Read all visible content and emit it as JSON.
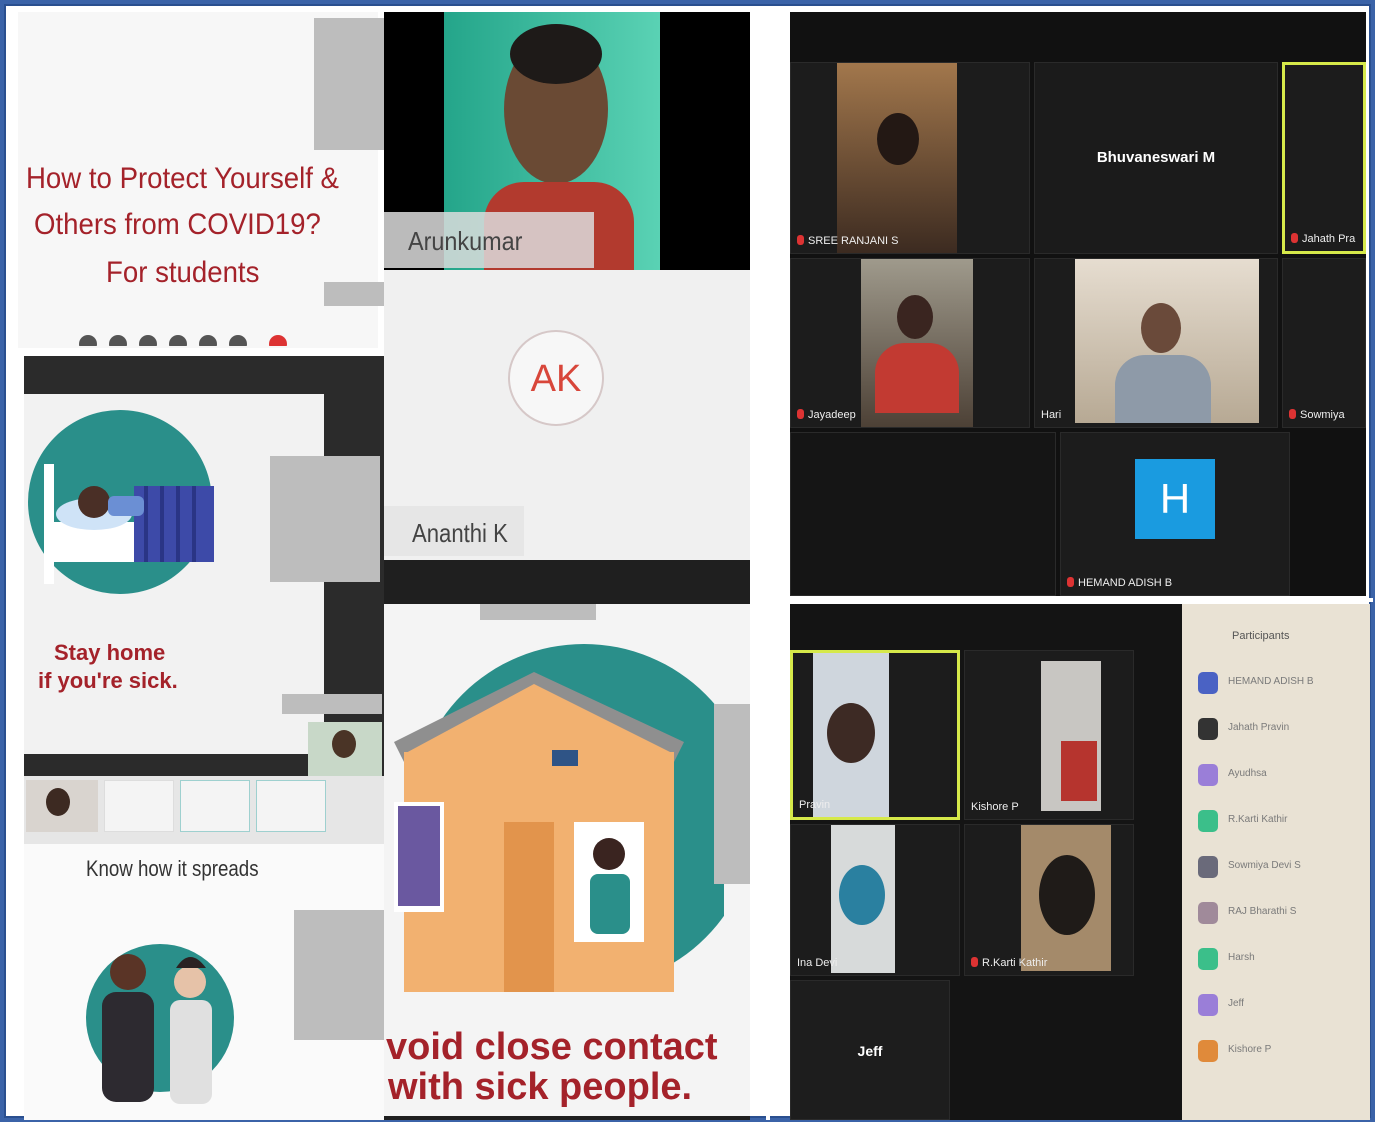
{
  "colors": {
    "border": "#3b63a8",
    "slide_red": "#a4222a",
    "zoom_blue": "#1a9be0",
    "zoom_active": "#d6e94a",
    "teal": "#2a8f8a"
  },
  "collage_left": {
    "slide_title": {
      "line1": "How to Protect Yourself &",
      "line2": "Others from COVID19?",
      "line3": "For students"
    },
    "slide_stay_home": {
      "line1": "Stay home",
      "line2": "if you're sick."
    },
    "slide_spreads": {
      "text": "Know how it spreads"
    },
    "video_arunkumar": {
      "name": "Arunkumar"
    },
    "avatar_ak": {
      "initials": "AK",
      "name": "Ananthi K"
    },
    "slide_avoid": {
      "line1": "void close contact",
      "line2": "with sick people."
    }
  },
  "zoom_grid_top": {
    "tiles": [
      {
        "name": "SREE RANJANI S"
      },
      {
        "name": "Bhuvaneswari M"
      },
      {
        "name": "Jahath Pra"
      },
      {
        "name": "Jayadeep"
      },
      {
        "name": "Hari"
      },
      {
        "name": "Sowmiya"
      },
      {
        "name": "HEMAND ADISH B",
        "initial": "H"
      }
    ]
  },
  "zoom_grid_bottom": {
    "tiles": [
      {
        "name": "Pravin"
      },
      {
        "name": "Kishore P"
      },
      {
        "name": "Ina Devi"
      },
      {
        "name": "R.Karti Kathir"
      },
      {
        "name": "Jeff"
      }
    ],
    "participants_header": "Participants",
    "participants": [
      {
        "name": "HEMAND ADISH B"
      },
      {
        "name": "Jahath Pravin"
      },
      {
        "name": "Ayudhsa"
      },
      {
        "name": "R.Karti Kathir"
      },
      {
        "name": "Sowmiya Devi S"
      },
      {
        "name": "RAJ Bharathi S"
      },
      {
        "name": "Harsh"
      },
      {
        "name": "Jeff"
      },
      {
        "name": "Kishore P"
      }
    ]
  }
}
